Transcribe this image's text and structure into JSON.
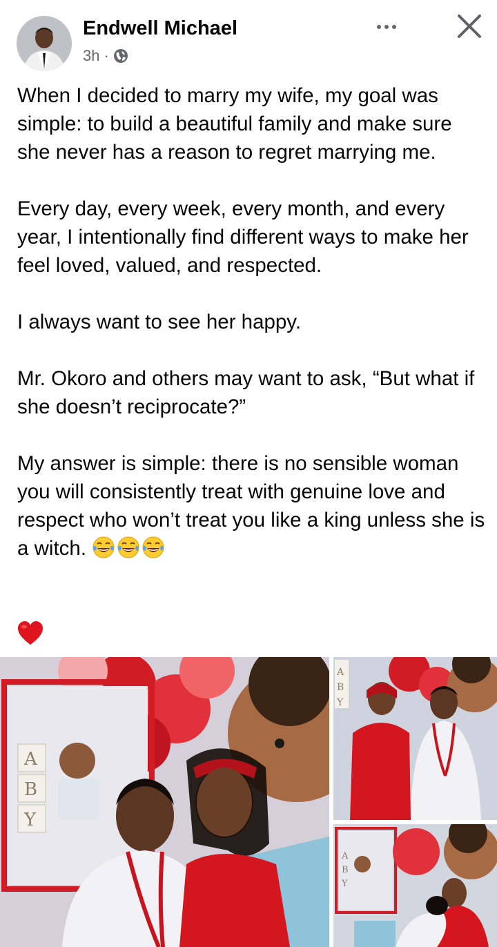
{
  "post": {
    "author": "Endwell Michael",
    "time": "3h",
    "separator": "·",
    "privacy_icon": "globe-icon",
    "paragraphs": [
      "When I decided to marry my wife, my goal was simple: to build a beautiful family and make sure she never has a reason to regret marrying me.",
      "Every day, every week, every month, and every year, I intentionally find different ways to make her feel loved, valued, and respected.",
      "I always want to see her happy.",
      "Mr. Okoro and others may want to ask, “But what if she doesn’t reciprocate?”",
      "My answer is simple: there is no sensible woman you will consistently treat with genuine love and respect who won’t treat you like a king unless she is a witch."
    ],
    "trailing_emojis": [
      "face-with-tears-of-joy",
      "face-with-tears-of-joy",
      "face-with-tears-of-joy"
    ],
    "reaction_emoji": "red-heart"
  },
  "photos": {
    "backdrop_letters": [
      "A",
      "B",
      "Y"
    ],
    "count": 3
  },
  "colors": {
    "text": "#050505",
    "secondary": "#65676b",
    "accent_red": "#e0141e"
  }
}
